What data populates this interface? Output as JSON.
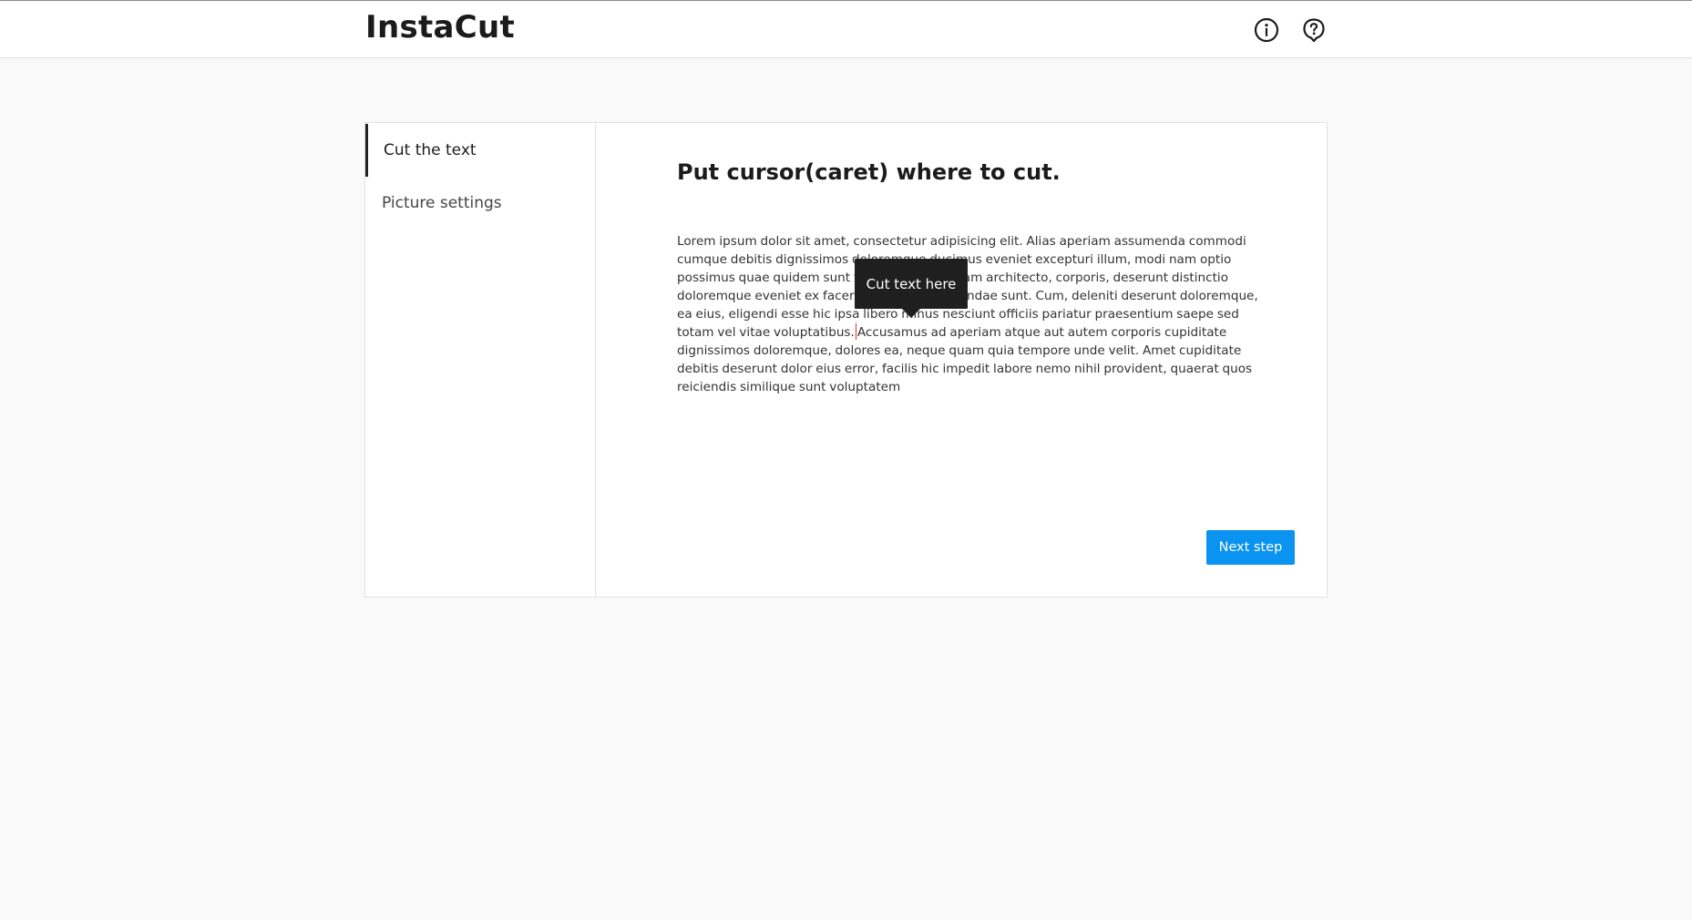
{
  "app": {
    "title": "InstaCut"
  },
  "header": {
    "icons": [
      "info-icon",
      "help-icon"
    ]
  },
  "sidebar": {
    "items": [
      {
        "label": "Cut the text",
        "active": true
      },
      {
        "label": "Picture settings",
        "active": false
      }
    ]
  },
  "main": {
    "heading": "Put cursor(caret) where to cut.",
    "text_before_caret": "Lorem ipsum dolor sit amet, consectetur adipisicing elit. Alias aperiam assumenda commodi cumque debitis dignissimos doloremque ducimus eveniet excepturi illum, modi nam optio possimus quae quidem sunt temporibus. Aliquam architecto, corporis, deserunt distinctio doloremque eveniet ex facere, impedit repudiandae sunt. Cum, deleniti deserunt doloremque, ea eius, eligendi esse hic ipsa libero minus nesciunt officiis pariatur praesentium saepe sed totam vel vitae voluptatibus.",
    "text_after_caret": "Accusamus ad aperiam atque aut autem corporis cupiditate dignissimos doloremque, dolores ea, neque quam quia tempore unde velit. Amet cupiditate debitis deserunt dolor eius error, facilis hic impedit labore nemo nihil provident, quaerat quos reiciendis similique sunt voluptatem",
    "tooltip": "Cut text here",
    "next_button": "Next step"
  },
  "colors": {
    "accent": "#0a93f0",
    "tooltip_bg": "#1f1f1f",
    "caret": "#d0342c",
    "page_bg": "#f9f9f9"
  }
}
